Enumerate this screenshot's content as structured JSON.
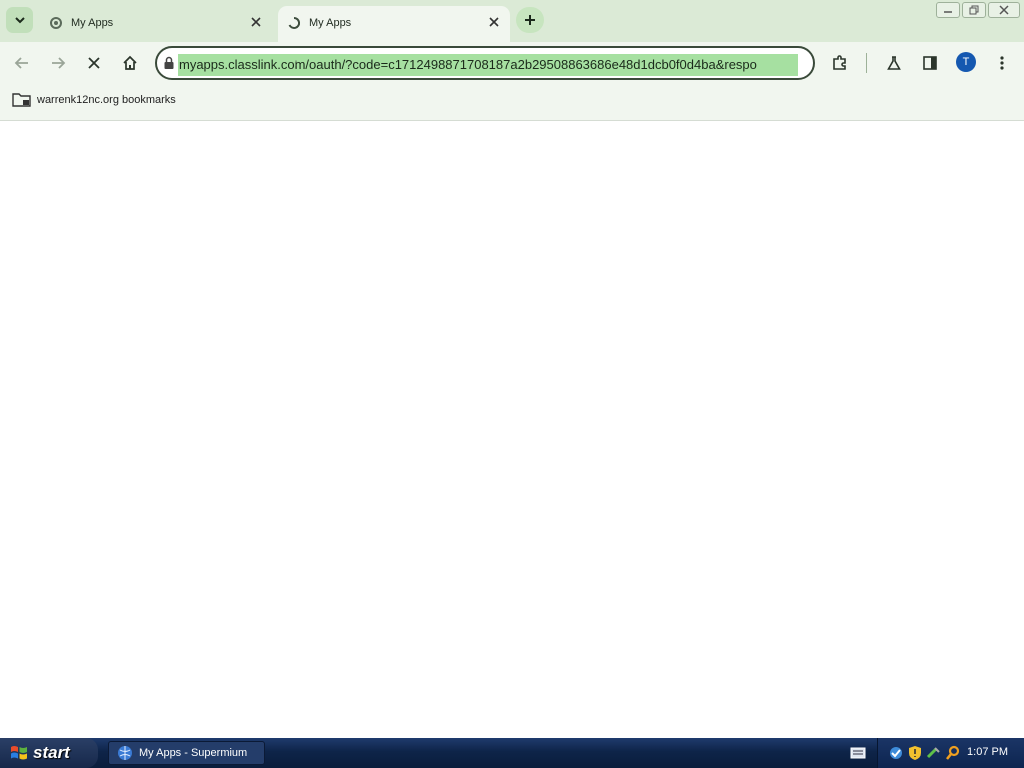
{
  "browser": {
    "tabs": [
      {
        "title": "My Apps",
        "active": false
      },
      {
        "title": "My Apps",
        "active": true
      }
    ],
    "url": "myapps.classlink.com/oauth/?code=c1712498871708187a2b29508863686e48d1dcb0f0d4ba&respo",
    "profile_initial": "T",
    "bookmarks": [
      {
        "label": "warrenk12nc.org bookmarks",
        "icon": "folder-icon"
      }
    ]
  },
  "taskbar": {
    "start_label": "start",
    "tasks": [
      {
        "label": "My Apps - Supermium",
        "icon": "browser-icon"
      }
    ],
    "clock": "1:07 PM",
    "tray_icons": [
      "network-icon",
      "security-shield-icon",
      "safely-remove-icon",
      "search-icon"
    ]
  },
  "colors": {
    "chrome_bg": "#dbead6",
    "toolbar_bg": "#f1f6ef",
    "url_highlight": "#a6e0a1",
    "taskbar": "#0e2449",
    "avatar": "#1558b0"
  }
}
